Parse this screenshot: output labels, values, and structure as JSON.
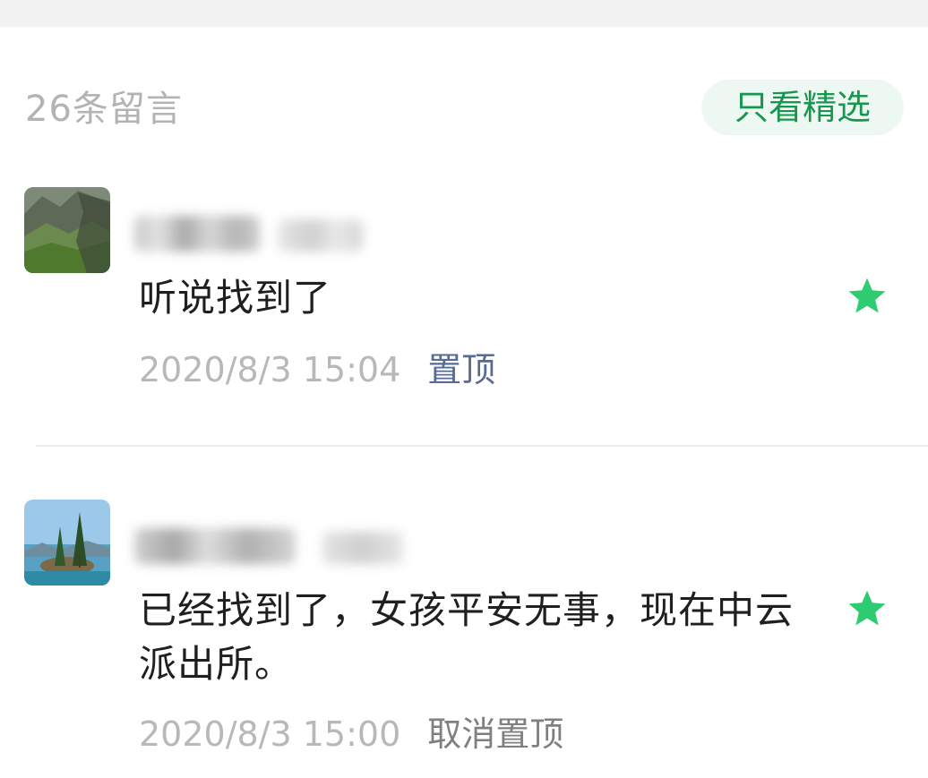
{
  "header": {
    "comment_count_label": "26条留言",
    "filter_button_label": "只看精选"
  },
  "comments": [
    {
      "text": "听说找到了",
      "timestamp": "2020/8/3 15:04",
      "action_label": "置顶",
      "featured": true,
      "avatar": "mountain-landscape"
    },
    {
      "text": "已经找到了，女孩平安无事，现在中云派出所。",
      "timestamp": "2020/8/3 15:00",
      "action_label": "取消置顶",
      "featured": true,
      "avatar": "lake-island-trees"
    }
  ],
  "colors": {
    "accent_green": "#16964f",
    "star_green": "#2ecc71",
    "link_blue": "#576b95"
  }
}
